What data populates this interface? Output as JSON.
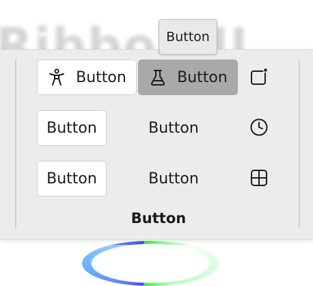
{
  "background": {
    "text": "Ribbon II"
  },
  "tooltip": {
    "text": "Button"
  },
  "ribbon": {
    "row1": {
      "btn1": {
        "label": "Button",
        "icon": "accessibility-icon"
      },
      "btn2": {
        "label": "Button",
        "icon": "beaker-icon",
        "state": "pressed"
      },
      "btn3": {
        "icon": "window-badge-icon"
      }
    },
    "row2": {
      "btn1": {
        "label": "Button"
      },
      "btn2": {
        "label": "Button"
      },
      "btn3": {
        "icon": "clock-icon"
      }
    },
    "row3": {
      "btn1": {
        "label": "Button"
      },
      "btn2": {
        "label": "Button"
      },
      "btn3": {
        "icon": "layout-grid-icon"
      }
    },
    "group_label": "Button"
  },
  "colors": {
    "panel": "#ececea",
    "pressed": "#a9a9a7",
    "button_bg": "#ffffff"
  }
}
